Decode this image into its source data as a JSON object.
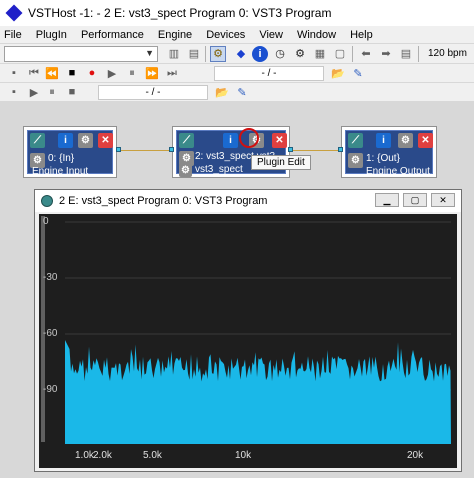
{
  "window": {
    "title": "VSTHost -1:  - 2 E: vst3_spect Program 0: VST3 Program"
  },
  "menu": {
    "items": [
      "File",
      "PlugIn",
      "Performance",
      "Engine",
      "Devices",
      "View",
      "Window",
      "Help"
    ]
  },
  "toolbar": {
    "bpm": "120 bpm",
    "position_1": "- / -",
    "position_2": "- / -"
  },
  "plugins": {
    "input": {
      "slot": "0: {In}",
      "name": "Engine Input"
    },
    "spect": {
      "slot": "2: vst3_spect vst3",
      "name": "vst3_spect"
    },
    "output": {
      "slot": "1: {Out}",
      "name": "Engine Output"
    }
  },
  "tooltip": {
    "text": "Plugin Edit"
  },
  "editor": {
    "title": "2 E: vst3_spect Program 0: VST3 Program",
    "y_ticks": [
      "0",
      "-30",
      "-60",
      "-90"
    ],
    "x_ticks": [
      "1.0k",
      "2.0k",
      "5.0k",
      "10k",
      "20k"
    ]
  },
  "chart_data": {
    "type": "area",
    "x_scale": "log",
    "y_ticks": [
      0,
      -30,
      -60,
      -90
    ],
    "x_ticks": [
      "1.0k",
      "2.0k",
      "5.0k",
      "10k",
      "20k"
    ],
    "series_color": "#1ab8e8",
    "background": "#1e1e1e",
    "level_db": -70
  },
  "colors": {
    "plugin_bg": "#2a4a8a",
    "spectrum": "#1ab8e8",
    "highlight": "#d01010"
  }
}
